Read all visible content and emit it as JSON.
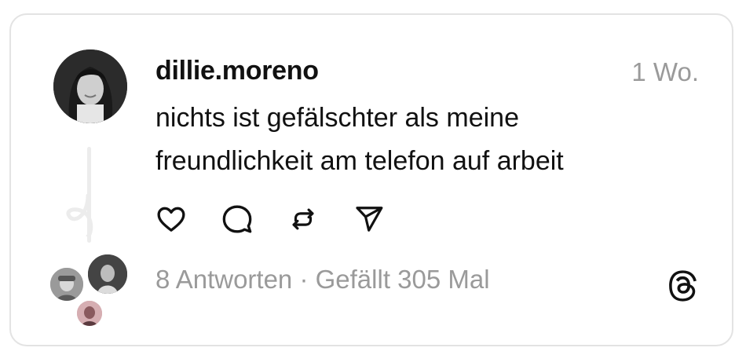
{
  "post": {
    "username": "dillie.moreno",
    "time": "1 Wo.",
    "text_line1": "nichts ist gefälschter als meine",
    "text_line2": "freundlichkeit am telefon auf arbeit"
  },
  "actions": {
    "like_icon": "heart-icon",
    "reply_icon": "speech-bubble-icon",
    "repost_icon": "repost-icon",
    "share_icon": "send-icon"
  },
  "stats": {
    "replies": "8 Antworten",
    "separator": " · ",
    "likes": "Gefällt 305 Mal"
  },
  "brand": {
    "logo_icon": "threads-logo-icon"
  }
}
